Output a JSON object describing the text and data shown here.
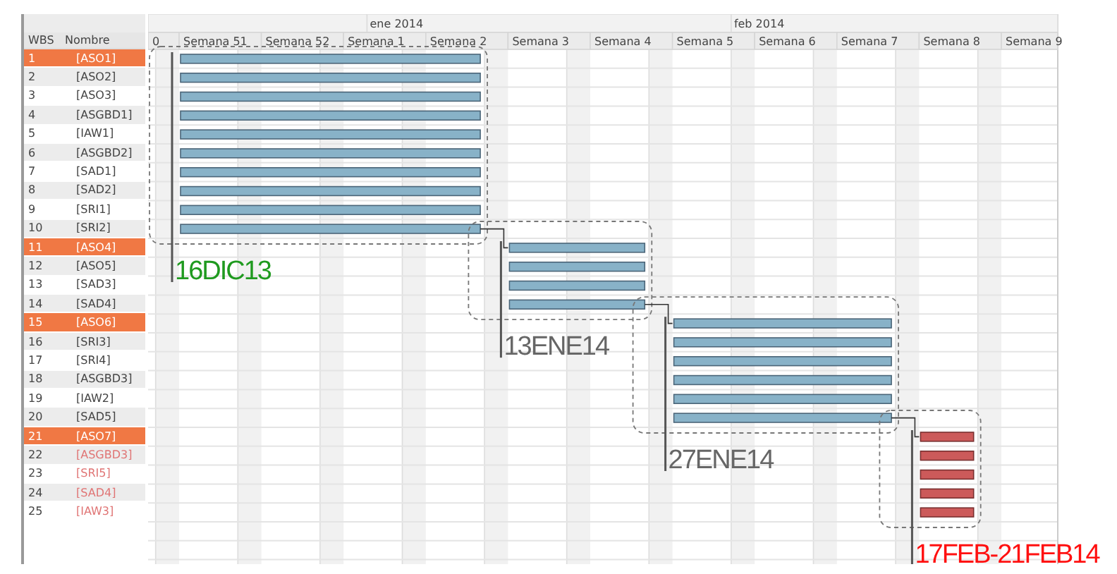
{
  "table": {
    "columns": [
      "WBS",
      "Nombre"
    ]
  },
  "timeline": {
    "months": [
      {
        "label": "ene 2014"
      },
      {
        "label": "feb 2014"
      }
    ],
    "weeks": [
      "0",
      "Semana 51",
      "Semana 52",
      "Semana 1",
      "Semana 2",
      "Semana 3",
      "Semana 4",
      "Semana 5",
      "Semana 6",
      "Semana 7",
      "Semana 8",
      "Semana 9"
    ]
  },
  "phases": [
    {
      "label": "16DIC13",
      "color": "#1f9a1f",
      "tasks": [
        {
          "wbs": "1",
          "name": "[ASO1]",
          "selected": true,
          "critical": false
        },
        {
          "wbs": "2",
          "name": "[ASO2]",
          "selected": false,
          "critical": false
        },
        {
          "wbs": "3",
          "name": "[ASO3]",
          "selected": false,
          "critical": false
        },
        {
          "wbs": "4",
          "name": "[ASGBD1]",
          "selected": false,
          "critical": false
        },
        {
          "wbs": "5",
          "name": "[IAW1]",
          "selected": false,
          "critical": false
        },
        {
          "wbs": "6",
          "name": "[ASGBD2]",
          "selected": false,
          "critical": false
        },
        {
          "wbs": "7",
          "name": "[SAD1]",
          "selected": false,
          "critical": false
        },
        {
          "wbs": "8",
          "name": "[SAD2]",
          "selected": false,
          "critical": false
        },
        {
          "wbs": "9",
          "name": "[SRI1]",
          "selected": false,
          "critical": false
        },
        {
          "wbs": "10",
          "name": "[SRI2]",
          "selected": false,
          "critical": false
        }
      ]
    },
    {
      "label": "13ENE14",
      "color": "#666666",
      "tasks": [
        {
          "wbs": "11",
          "name": "[ASO4]",
          "selected": true,
          "critical": false
        },
        {
          "wbs": "12",
          "name": "[ASO5]",
          "selected": false,
          "critical": false
        },
        {
          "wbs": "13",
          "name": "[SAD3]",
          "selected": false,
          "critical": false
        },
        {
          "wbs": "14",
          "name": "[SAD4]",
          "selected": false,
          "critical": false
        }
      ]
    },
    {
      "label": "27ENE14",
      "color": "#666666",
      "tasks": [
        {
          "wbs": "15",
          "name": "[ASO6]",
          "selected": true,
          "critical": false
        },
        {
          "wbs": "16",
          "name": "[SRI3]",
          "selected": false,
          "critical": false
        },
        {
          "wbs": "17",
          "name": "[SRI4]",
          "selected": false,
          "critical": false
        },
        {
          "wbs": "18",
          "name": "[ASGBD3]",
          "selected": false,
          "critical": false
        },
        {
          "wbs": "19",
          "name": "[IAW2]",
          "selected": false,
          "critical": false
        },
        {
          "wbs": "20",
          "name": "[SAD5]",
          "selected": false,
          "critical": false
        }
      ]
    },
    {
      "label": "17FEB-21FEB14",
      "color": "#ff1010",
      "tasks": [
        {
          "wbs": "21",
          "name": "[ASO7]",
          "selected": true,
          "critical": true
        },
        {
          "wbs": "22",
          "name": "[ASGBD3]",
          "selected": false,
          "critical": true
        },
        {
          "wbs": "23",
          "name": "[SRI5]",
          "selected": false,
          "critical": true
        },
        {
          "wbs": "24",
          "name": "[SAD4]",
          "selected": false,
          "critical": true
        },
        {
          "wbs": "25",
          "name": "[IAW3]",
          "selected": false,
          "critical": true
        }
      ]
    }
  ]
}
